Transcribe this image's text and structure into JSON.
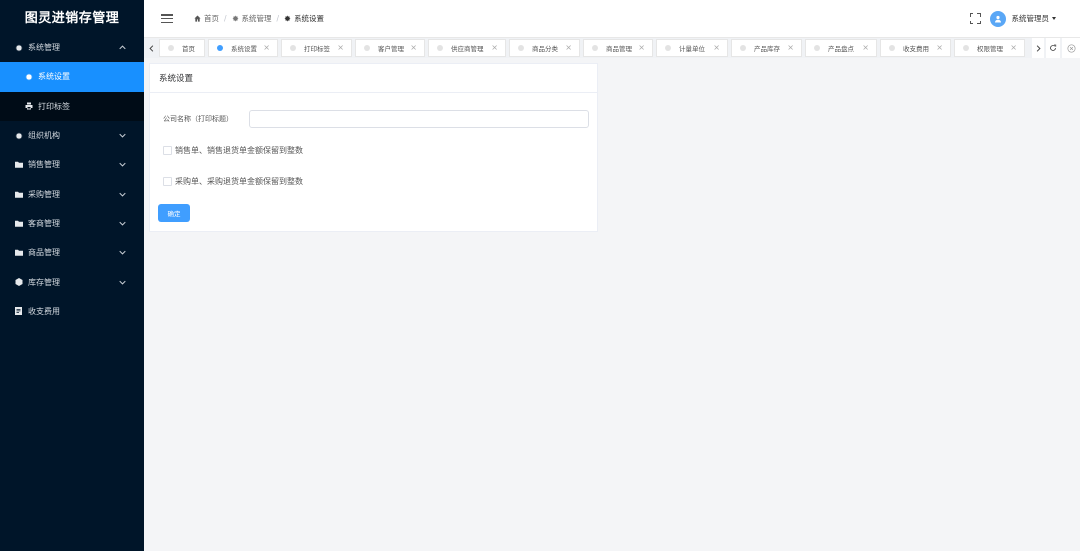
{
  "app": {
    "title": "图灵进销存管理"
  },
  "sidebar": {
    "items": [
      {
        "label": "系统管理",
        "icon": "gear-icon",
        "expanded": true,
        "children": [
          {
            "label": "系统设置",
            "icon": "gear-icon",
            "active": true
          },
          {
            "label": "打印标签",
            "icon": "printer-icon",
            "active": false
          }
        ]
      },
      {
        "label": "组织机构",
        "icon": "gear-icon"
      },
      {
        "label": "销售管理",
        "icon": "folder-icon"
      },
      {
        "label": "采购管理",
        "icon": "folder-icon"
      },
      {
        "label": "客商管理",
        "icon": "folder-icon"
      },
      {
        "label": "商品管理",
        "icon": "folder-icon"
      },
      {
        "label": "库存管理",
        "icon": "cube-icon"
      },
      {
        "label": "收支费用",
        "icon": "document-icon"
      }
    ]
  },
  "header": {
    "breadcrumb": [
      {
        "label": "首页",
        "icon": "home-icon"
      },
      {
        "label": "系统管理",
        "icon": "gear-icon"
      },
      {
        "label": "系统设置",
        "icon": "gear-icon"
      }
    ],
    "username": "系统管理员"
  },
  "tabs": [
    {
      "label": "首页",
      "active": false,
      "closable": false
    },
    {
      "label": "系统设置",
      "active": true,
      "closable": true
    },
    {
      "label": "打印标签",
      "active": false,
      "closable": true
    },
    {
      "label": "客户管理",
      "active": false,
      "closable": true
    },
    {
      "label": "供应商管理",
      "active": false,
      "closable": true
    },
    {
      "label": "商品分类",
      "active": false,
      "closable": true
    },
    {
      "label": "商品管理",
      "active": false,
      "closable": true
    },
    {
      "label": "计量单位",
      "active": false,
      "closable": true
    },
    {
      "label": "产品库存",
      "active": false,
      "closable": true
    },
    {
      "label": "产品盘点",
      "active": false,
      "closable": true
    },
    {
      "label": "收支费用",
      "active": false,
      "closable": true
    },
    {
      "label": "权限管理",
      "active": false,
      "closable": true
    }
  ],
  "settings": {
    "title": "系统设置",
    "company_label": "公司名称（打印标题）",
    "company_value": "",
    "check_sales": "销售单、销售退货单金额保留到整数",
    "check_purchase": "采购单、采购退货单金额保留到整数",
    "confirm_label": "确定"
  },
  "colors": {
    "sidebar_bg": "#001529",
    "accent": "#1890ff",
    "button": "#409eff"
  }
}
